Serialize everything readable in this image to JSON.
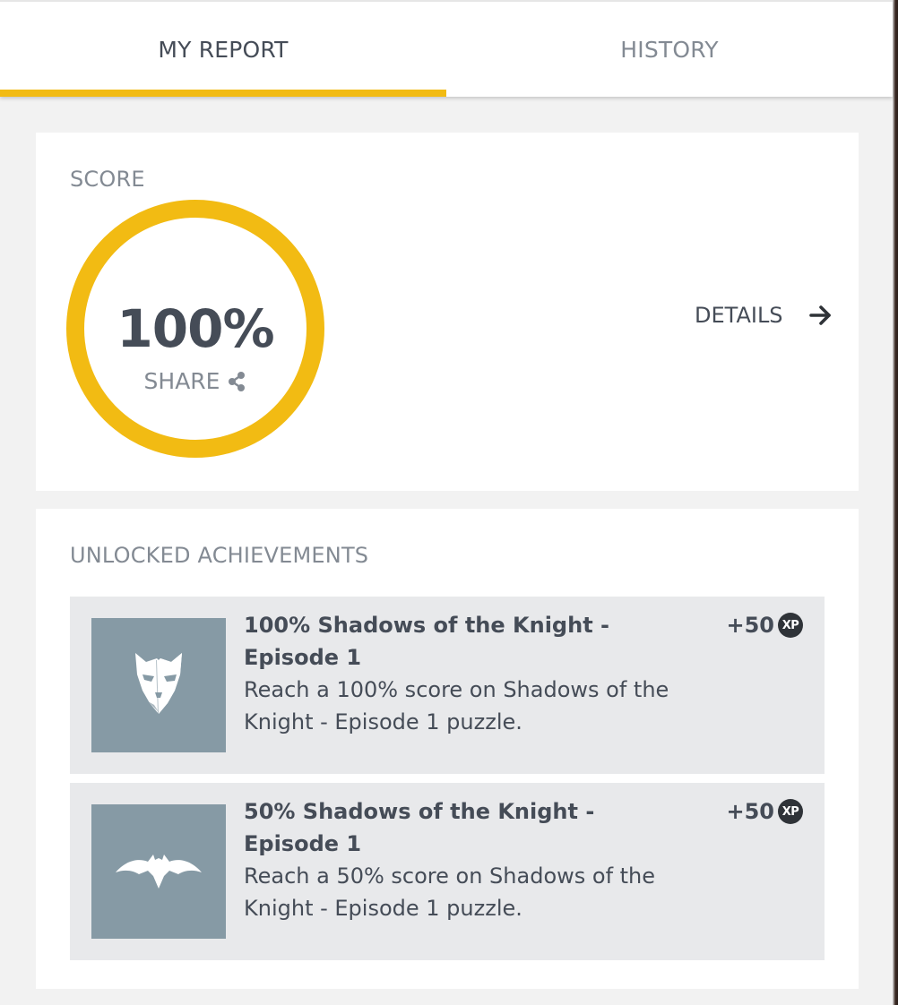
{
  "tabs": [
    {
      "label": "MY REPORT",
      "active": true
    },
    {
      "label": "HISTORY",
      "active": false
    }
  ],
  "score": {
    "section_label": "SCORE",
    "value": "100%",
    "progress": 1.0,
    "share_label": "SHARE",
    "share_icon": "share-icon",
    "details_label": "DETAILS",
    "details_icon": "arrow-right-icon"
  },
  "achievements": {
    "section_label": "UNLOCKED ACHIEVEMENTS",
    "items": [
      {
        "title": "100% Shadows of the Knight - Episode 1",
        "description": "Reach a 100% score on Shadows of the Knight - Episode 1 puzzle.",
        "xp": "+50",
        "xp_badge": "XP",
        "icon": "mask-icon"
      },
      {
        "title": "50% Shadows of the Knight - Episode 1",
        "description": "Reach a 50% score on Shadows of the Knight - Episode 1 puzzle.",
        "xp": "+50",
        "xp_badge": "XP",
        "icon": "bat-icon"
      }
    ]
  },
  "colors": {
    "accent": "#f2bb13",
    "text_dark": "#454c57",
    "text_muted": "#838a93",
    "card_bg": "#ffffff",
    "page_bg": "#f2f2f2",
    "item_bg": "#e8e9eb",
    "thumb_bg": "#869aa5"
  }
}
